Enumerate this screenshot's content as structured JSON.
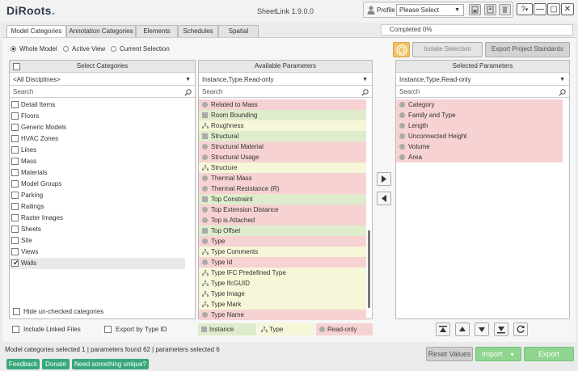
{
  "app": {
    "logo_main": "DiRoots",
    "logo_dot": ".",
    "title": "SheetLink 1.9.0.0"
  },
  "profile": {
    "label": "Profile",
    "selected": "Please Select"
  },
  "window": {
    "help": "?",
    "help_caret": "▾",
    "minimize": "—",
    "maximize": "▢",
    "close": "✕"
  },
  "tabs": [
    {
      "label": "Model Categories",
      "active": true
    },
    {
      "label": "Annotation Categories",
      "active": false
    },
    {
      "label": "Elements",
      "active": false
    },
    {
      "label": "Schedules",
      "active": false
    },
    {
      "label": "Spatial",
      "active": false
    }
  ],
  "progress_text": "Completed   0%",
  "scope": {
    "whole_model": "Whole Model",
    "active_view": "Active View",
    "current_selection": "Current Selection"
  },
  "toolbar": {
    "isolate_selection": "Isolate Selection",
    "export_standards": "Export Project Standards"
  },
  "categories_panel": {
    "header": "Select Categories",
    "discipline": "<All Disciplines>",
    "search_placeholder": "Search",
    "items": [
      {
        "label": "Detail Items",
        "checked": false
      },
      {
        "label": "Floors",
        "checked": false
      },
      {
        "label": "Generic Models",
        "checked": false
      },
      {
        "label": "HVAC Zones",
        "checked": false
      },
      {
        "label": "Lines",
        "checked": false
      },
      {
        "label": "Mass",
        "checked": false
      },
      {
        "label": "Materials",
        "checked": false
      },
      {
        "label": "Model Groups",
        "checked": false
      },
      {
        "label": "Parking",
        "checked": false
      },
      {
        "label": "Railings",
        "checked": false
      },
      {
        "label": "Raster Images",
        "checked": false
      },
      {
        "label": "Sheets",
        "checked": false
      },
      {
        "label": "Site",
        "checked": false
      },
      {
        "label": "Views",
        "checked": false
      },
      {
        "label": "Walls",
        "checked": true
      }
    ],
    "hide_unchecked": "Hide un-checked categories"
  },
  "available_panel": {
    "header": "Available Parameters",
    "filter": "Instance,Type,Read-only",
    "search_placeholder": "Search",
    "items": [
      {
        "label": "Related to Mass",
        "kind": "readonly"
      },
      {
        "label": "Room Bounding",
        "kind": "instance"
      },
      {
        "label": "Roughness",
        "kind": "type"
      },
      {
        "label": "Structural",
        "kind": "instance"
      },
      {
        "label": "Structural Material",
        "kind": "readonly"
      },
      {
        "label": "Structural Usage",
        "kind": "readonly"
      },
      {
        "label": "Structure",
        "kind": "type"
      },
      {
        "label": "Thermal Mass",
        "kind": "readonly"
      },
      {
        "label": "Thermal Resistance (R)",
        "kind": "readonly"
      },
      {
        "label": "Top Constraint",
        "kind": "instance"
      },
      {
        "label": "Top Extension Distance",
        "kind": "readonly"
      },
      {
        "label": "Top is Attached",
        "kind": "readonly"
      },
      {
        "label": "Top Offset",
        "kind": "instance"
      },
      {
        "label": "Type",
        "kind": "readonly"
      },
      {
        "label": "Type Comments",
        "kind": "type"
      },
      {
        "label": "Type Id",
        "kind": "readonly"
      },
      {
        "label": "Type IFC Predefined Type",
        "kind": "type"
      },
      {
        "label": "Type IfcGUID",
        "kind": "type"
      },
      {
        "label": "Type Image",
        "kind": "type"
      },
      {
        "label": "Type Mark",
        "kind": "type"
      },
      {
        "label": "Type Name",
        "kind": "readonly"
      }
    ]
  },
  "selected_panel": {
    "header": "Selected Parameters",
    "filter": "Instance,Type,Read-only",
    "search_placeholder": "Search",
    "items": [
      {
        "label": "Category",
        "kind": "readonly"
      },
      {
        "label": "Family and Type",
        "kind": "readonly"
      },
      {
        "label": "Length",
        "kind": "readonly"
      },
      {
        "label": "Unconnected Height",
        "kind": "readonly"
      },
      {
        "label": "Volume",
        "kind": "readonly"
      },
      {
        "label": "Area",
        "kind": "readonly"
      }
    ]
  },
  "options": {
    "include_linked": "Include Linked Files",
    "export_by_type": "Export by Type ID"
  },
  "legend": {
    "instance": "Instance",
    "type": "Type",
    "readonly": "Read-only"
  },
  "status": "Model categories selected 1 | parameters found 62 | parameters selected 6",
  "actions": {
    "reset": "Reset Values",
    "import": "Import",
    "export": "Export"
  },
  "links": {
    "feedback": "Feedback",
    "donate": "Donate",
    "unique": "Need something unique?"
  },
  "colors": {
    "instance": "#dfeccb",
    "type": "#f6f6d8",
    "readonly": "#f7d2d2",
    "accent_green": "#8fd48f",
    "link_green": "#38a87a"
  }
}
